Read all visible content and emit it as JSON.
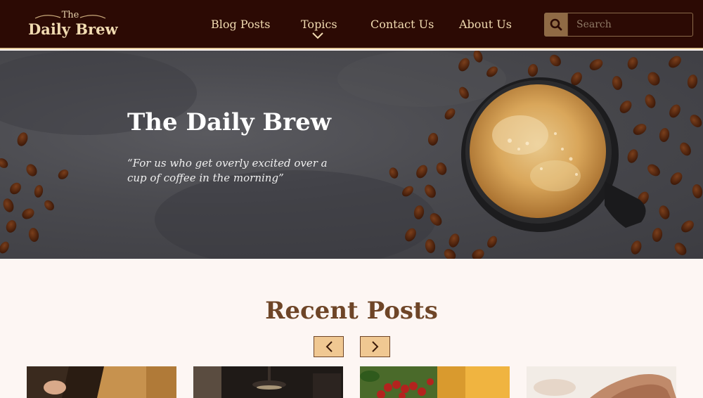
{
  "logo": {
    "small": "The",
    "main": "Daily Brew"
  },
  "nav": {
    "items": [
      "Blog Posts",
      "Topics",
      "Contact Us",
      "About Us"
    ]
  },
  "search": {
    "placeholder": "Search",
    "icon": "search-icon"
  },
  "hero": {
    "title": "The Daily Brew",
    "quote": "“For us who get overly excited over a cup of coffee in the morning”"
  },
  "recent": {
    "title": "Recent Posts",
    "prev_icon": "chevron-left-icon",
    "next_icon": "chevron-right-icon"
  },
  "colors": {
    "header_bg": "#2c0a04",
    "accent_gold": "#f1dbb1",
    "button_tan": "#f0c892",
    "title_brown": "#6e4527",
    "page_bg": "#fdf6f3"
  }
}
